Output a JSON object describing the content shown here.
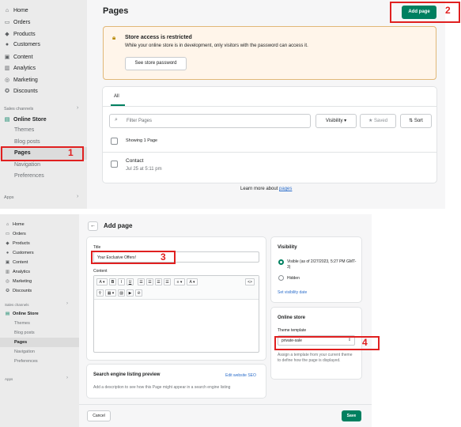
{
  "panel1": {
    "sidebar": {
      "items": [
        {
          "label": "Home",
          "icon": "home-icon"
        },
        {
          "label": "Orders",
          "icon": "orders-icon"
        },
        {
          "label": "Products",
          "icon": "products-icon"
        },
        {
          "label": "Customers",
          "icon": "customers-icon"
        },
        {
          "label": "Content",
          "icon": "content-icon"
        },
        {
          "label": "Analytics",
          "icon": "analytics-icon"
        },
        {
          "label": "Marketing",
          "icon": "marketing-icon"
        },
        {
          "label": "Discounts",
          "icon": "discounts-icon"
        }
      ],
      "sales_channels": "Sales channels",
      "online_store": "Online Store",
      "sub_items": [
        "Themes",
        "Blog posts",
        "Pages",
        "Navigation",
        "Preferences"
      ],
      "apps": "Apps"
    },
    "header": {
      "title": "Pages",
      "add_button": "Add page"
    },
    "banner": {
      "title": "Store access is restricted",
      "text": "While your online store is in development, only visitors with the password can access it.",
      "button": "See store password"
    },
    "list": {
      "tab": "All",
      "filter_placeholder": "Filter Pages",
      "visibility": "Visibility",
      "saved": "Saved",
      "sort": "Sort",
      "showing": "Showing 1 Page",
      "rows": [
        {
          "title": "Contact",
          "date": "Jul 25 at 5:11 pm"
        }
      ]
    },
    "footer": {
      "prefix": "Learn more about ",
      "link": "pages"
    }
  },
  "panel2": {
    "sidebar": {
      "items": [
        "Home",
        "Orders",
        "Products",
        "Customers",
        "Content",
        "Analytics",
        "Marketing",
        "Discounts"
      ],
      "sales_channels": "Sales channels",
      "online_store": "Online Store",
      "sub_items": [
        "Themes",
        "Blog posts",
        "Pages",
        "Navigation",
        "Preferences"
      ],
      "apps": "Apps"
    },
    "header": {
      "title": "Add page"
    },
    "form": {
      "title_label": "Title",
      "title_value": "Your Exclusive Offers!",
      "content_label": "Content"
    },
    "seo": {
      "title": "Search engine listing preview",
      "edit_link": "Edit website SEO",
      "text": "Add a description to see how this Page might appear in a search engine listing"
    },
    "visibility": {
      "title": "Visibility",
      "visible_label": "Visible (as of 2/27/2023, 5:27 PM GMT-3)",
      "hidden_label": "Hidden",
      "set_date": "Set visibility date"
    },
    "online_store": {
      "title": "Online store",
      "template_label": "Theme template",
      "template_value": "private-sale",
      "help": "Assign a template from your current theme to define how the page is displayed."
    },
    "footer": {
      "cancel": "Cancel",
      "save": "Save"
    }
  },
  "annotations": [
    "1",
    "2",
    "3",
    "4"
  ],
  "colors": {
    "accent": "#008060",
    "annotation": "#e02020",
    "banner_bg": "#fff5ea",
    "link": "#2c6ecb"
  }
}
